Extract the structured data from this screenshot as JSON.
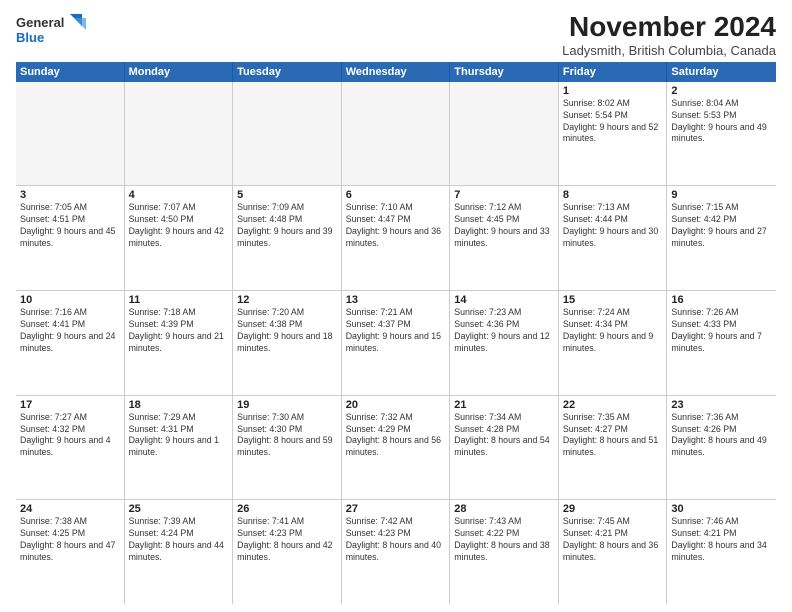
{
  "logo": {
    "line1": "General",
    "line2": "Blue",
    "icon_color": "#1a6bbf"
  },
  "title": "November 2024",
  "location": "Ladysmith, British Columbia, Canada",
  "header_days": [
    "Sunday",
    "Monday",
    "Tuesday",
    "Wednesday",
    "Thursday",
    "Friday",
    "Saturday"
  ],
  "rows": [
    [
      {
        "day": "",
        "info": ""
      },
      {
        "day": "",
        "info": ""
      },
      {
        "day": "",
        "info": ""
      },
      {
        "day": "",
        "info": ""
      },
      {
        "day": "",
        "info": ""
      },
      {
        "day": "1",
        "info": "Sunrise: 8:02 AM\nSunset: 5:54 PM\nDaylight: 9 hours and 52 minutes."
      },
      {
        "day": "2",
        "info": "Sunrise: 8:04 AM\nSunset: 5:53 PM\nDaylight: 9 hours and 49 minutes."
      }
    ],
    [
      {
        "day": "3",
        "info": "Sunrise: 7:05 AM\nSunset: 4:51 PM\nDaylight: 9 hours and 45 minutes."
      },
      {
        "day": "4",
        "info": "Sunrise: 7:07 AM\nSunset: 4:50 PM\nDaylight: 9 hours and 42 minutes."
      },
      {
        "day": "5",
        "info": "Sunrise: 7:09 AM\nSunset: 4:48 PM\nDaylight: 9 hours and 39 minutes."
      },
      {
        "day": "6",
        "info": "Sunrise: 7:10 AM\nSunset: 4:47 PM\nDaylight: 9 hours and 36 minutes."
      },
      {
        "day": "7",
        "info": "Sunrise: 7:12 AM\nSunset: 4:45 PM\nDaylight: 9 hours and 33 minutes."
      },
      {
        "day": "8",
        "info": "Sunrise: 7:13 AM\nSunset: 4:44 PM\nDaylight: 9 hours and 30 minutes."
      },
      {
        "day": "9",
        "info": "Sunrise: 7:15 AM\nSunset: 4:42 PM\nDaylight: 9 hours and 27 minutes."
      }
    ],
    [
      {
        "day": "10",
        "info": "Sunrise: 7:16 AM\nSunset: 4:41 PM\nDaylight: 9 hours and 24 minutes."
      },
      {
        "day": "11",
        "info": "Sunrise: 7:18 AM\nSunset: 4:39 PM\nDaylight: 9 hours and 21 minutes."
      },
      {
        "day": "12",
        "info": "Sunrise: 7:20 AM\nSunset: 4:38 PM\nDaylight: 9 hours and 18 minutes."
      },
      {
        "day": "13",
        "info": "Sunrise: 7:21 AM\nSunset: 4:37 PM\nDaylight: 9 hours and 15 minutes."
      },
      {
        "day": "14",
        "info": "Sunrise: 7:23 AM\nSunset: 4:36 PM\nDaylight: 9 hours and 12 minutes."
      },
      {
        "day": "15",
        "info": "Sunrise: 7:24 AM\nSunset: 4:34 PM\nDaylight: 9 hours and 9 minutes."
      },
      {
        "day": "16",
        "info": "Sunrise: 7:26 AM\nSunset: 4:33 PM\nDaylight: 9 hours and 7 minutes."
      }
    ],
    [
      {
        "day": "17",
        "info": "Sunrise: 7:27 AM\nSunset: 4:32 PM\nDaylight: 9 hours and 4 minutes."
      },
      {
        "day": "18",
        "info": "Sunrise: 7:29 AM\nSunset: 4:31 PM\nDaylight: 9 hours and 1 minute."
      },
      {
        "day": "19",
        "info": "Sunrise: 7:30 AM\nSunset: 4:30 PM\nDaylight: 8 hours and 59 minutes."
      },
      {
        "day": "20",
        "info": "Sunrise: 7:32 AM\nSunset: 4:29 PM\nDaylight: 8 hours and 56 minutes."
      },
      {
        "day": "21",
        "info": "Sunrise: 7:34 AM\nSunset: 4:28 PM\nDaylight: 8 hours and 54 minutes."
      },
      {
        "day": "22",
        "info": "Sunrise: 7:35 AM\nSunset: 4:27 PM\nDaylight: 8 hours and 51 minutes."
      },
      {
        "day": "23",
        "info": "Sunrise: 7:36 AM\nSunset: 4:26 PM\nDaylight: 8 hours and 49 minutes."
      }
    ],
    [
      {
        "day": "24",
        "info": "Sunrise: 7:38 AM\nSunset: 4:25 PM\nDaylight: 8 hours and 47 minutes."
      },
      {
        "day": "25",
        "info": "Sunrise: 7:39 AM\nSunset: 4:24 PM\nDaylight: 8 hours and 44 minutes."
      },
      {
        "day": "26",
        "info": "Sunrise: 7:41 AM\nSunset: 4:23 PM\nDaylight: 8 hours and 42 minutes."
      },
      {
        "day": "27",
        "info": "Sunrise: 7:42 AM\nSunset: 4:23 PM\nDaylight: 8 hours and 40 minutes."
      },
      {
        "day": "28",
        "info": "Sunrise: 7:43 AM\nSunset: 4:22 PM\nDaylight: 8 hours and 38 minutes."
      },
      {
        "day": "29",
        "info": "Sunrise: 7:45 AM\nSunset: 4:21 PM\nDaylight: 8 hours and 36 minutes."
      },
      {
        "day": "30",
        "info": "Sunrise: 7:46 AM\nSunset: 4:21 PM\nDaylight: 8 hours and 34 minutes."
      }
    ]
  ]
}
